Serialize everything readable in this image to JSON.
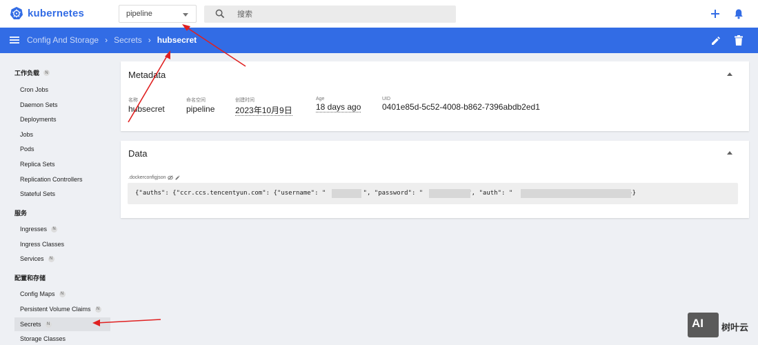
{
  "app": {
    "title": "kubernetes"
  },
  "topbar": {
    "namespace": "pipeline",
    "search_placeholder": "搜索"
  },
  "breadcrumb": {
    "items": [
      "Config And Storage",
      "Secrets"
    ],
    "current": "hubsecret"
  },
  "sidebar": {
    "groups": [
      {
        "label": "工作负载",
        "badge": "N",
        "items": [
          {
            "label": "Cron Jobs"
          },
          {
            "label": "Daemon Sets"
          },
          {
            "label": "Deployments"
          },
          {
            "label": "Jobs"
          },
          {
            "label": "Pods"
          },
          {
            "label": "Replica Sets"
          },
          {
            "label": "Replication Controllers"
          },
          {
            "label": "Stateful Sets"
          }
        ]
      },
      {
        "label": "服务",
        "items": [
          {
            "label": "Ingresses",
            "badge": "N"
          },
          {
            "label": "Ingress Classes"
          },
          {
            "label": "Services",
            "badge": "N"
          }
        ]
      },
      {
        "label": "配置和存储",
        "items": [
          {
            "label": "Config Maps",
            "badge": "N"
          },
          {
            "label": "Persistent Volume Claims",
            "badge": "N"
          },
          {
            "label": "Secrets",
            "badge": "N",
            "active": true
          },
          {
            "label": "Storage Classes"
          }
        ]
      }
    ]
  },
  "metadata": {
    "title": "Metadata",
    "fields": [
      {
        "label": "名称",
        "value": "hubsecret"
      },
      {
        "label": "命名空间",
        "value": "pipeline"
      },
      {
        "label": "创建时间",
        "value": "2023年10月9日"
      },
      {
        "label": "Age",
        "value": "18 days ago"
      },
      {
        "label": "UID",
        "value": "0401e85d-5c52-4008-b862-7396abdb2ed1"
      }
    ]
  },
  "data_card": {
    "title": "Data",
    "key": ".dockerconfigjson",
    "value": "{\"auths\": {\"ccr.ccs.tencentyun.com\": {\"username\": \"          \", \"password\": \"            \", \"auth\": \"                             \"}}}"
  },
  "watermark": {
    "logo": "AI",
    "text": "树叶云"
  },
  "colors": {
    "brand": "#326ce5",
    "arrow": "#e02020"
  }
}
